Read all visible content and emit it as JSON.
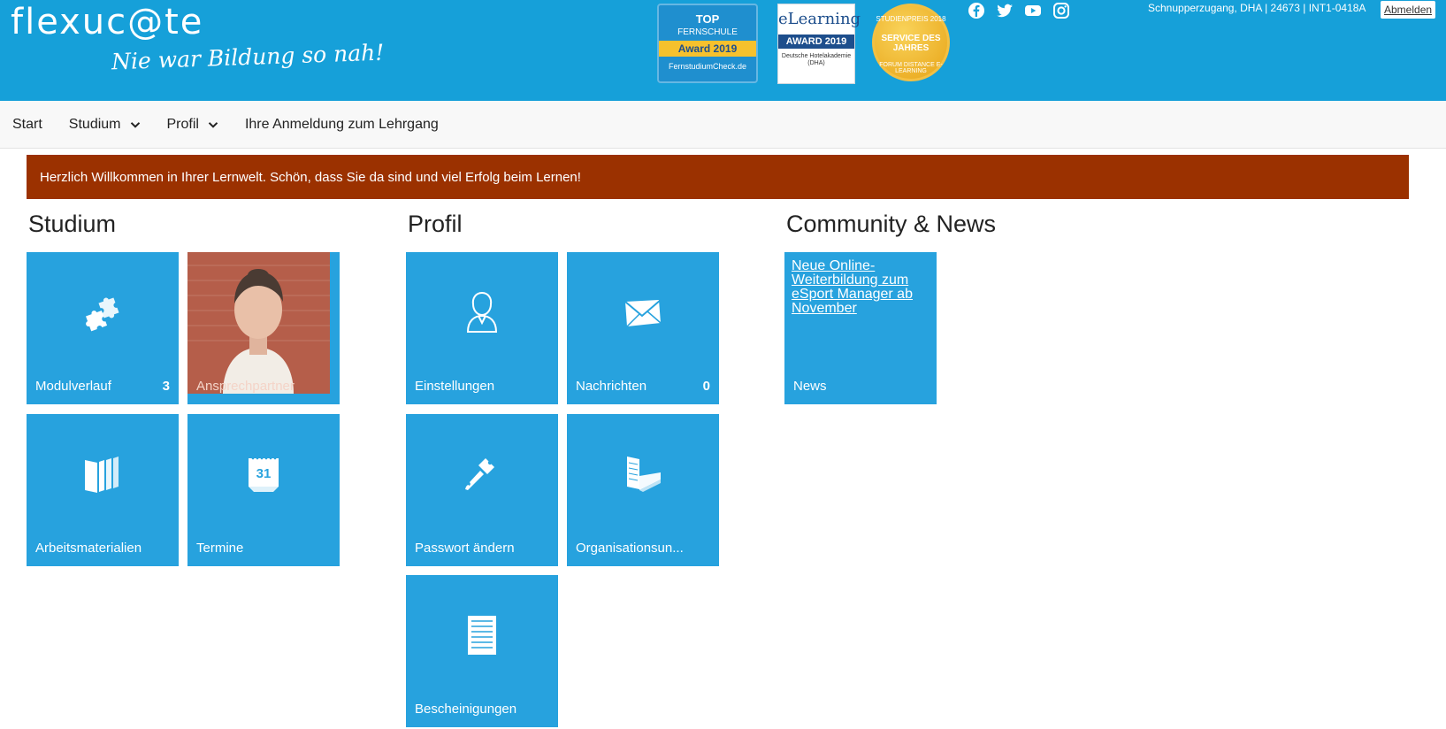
{
  "header": {
    "logo": "flexuc@te",
    "tagline": "Nie war Bildung so nah!",
    "user_info": "Schnupperzugang, DHA | 24673 | INT1-0418A",
    "logout_label": "Abmelden",
    "awards": {
      "fernschule": {
        "top": "TOP",
        "sub": "FERNSCHULE",
        "band": "Award 2019",
        "foot": "FernstudiumCheck.de"
      },
      "elearning": {
        "title": "eLearning",
        "band": "AWARD 2019",
        "foot": "Deutsche Hotelakademie (DHA)"
      },
      "studienpreis": {
        "ring": "STUDIENPREIS 2018",
        "main": "SERVICE DES JAHRES",
        "foot": "FORUM DISTANCE E-LEARNING"
      }
    },
    "social_icons": [
      "facebook-icon",
      "twitter-icon",
      "youtube-icon",
      "instagram-icon"
    ]
  },
  "nav": {
    "items": [
      {
        "label": "Start",
        "dropdown": false
      },
      {
        "label": "Studium",
        "dropdown": true
      },
      {
        "label": "Profil",
        "dropdown": true
      },
      {
        "label": "Ihre Anmeldung zum Lehrgang",
        "dropdown": false
      }
    ]
  },
  "banner": {
    "text": "Herzlich Willkommen in Ihrer Lernwelt. Schön, dass Sie da sind und viel Erfolg beim Lernen!"
  },
  "sections": {
    "studium": {
      "title": "Studium",
      "tiles": [
        {
          "label": "Modulverlauf",
          "count": "3",
          "icon": "puzzle-icon"
        },
        {
          "label": "Ansprechpartner",
          "icon": "contact-photo"
        },
        {
          "label": "Arbeitsmaterialien",
          "icon": "books-icon"
        },
        {
          "label": "Termine",
          "icon": "calendar-icon",
          "icon_text": "31"
        }
      ]
    },
    "profil": {
      "title": "Profil",
      "tiles": [
        {
          "label": "Einstellungen",
          "icon": "user-icon"
        },
        {
          "label": "Nachrichten",
          "count": "0",
          "icon": "envelope-icon"
        },
        {
          "label": "Passwort ändern",
          "icon": "key-icon"
        },
        {
          "label": "Organisationsun...",
          "icon": "building-icon"
        },
        {
          "label": "Bescheinigungen",
          "icon": "document-icon"
        }
      ]
    },
    "community": {
      "title": "Community & News",
      "tiles": [
        {
          "label": "News",
          "link": "Neue Online-Weiterbildung zum eSport Manager ab November"
        }
      ]
    }
  },
  "colors": {
    "header_bg": "#16a0d9",
    "tile_bg": "#27a2de",
    "banner_bg": "#9b3100",
    "nav_bg": "#f8f8f8"
  }
}
